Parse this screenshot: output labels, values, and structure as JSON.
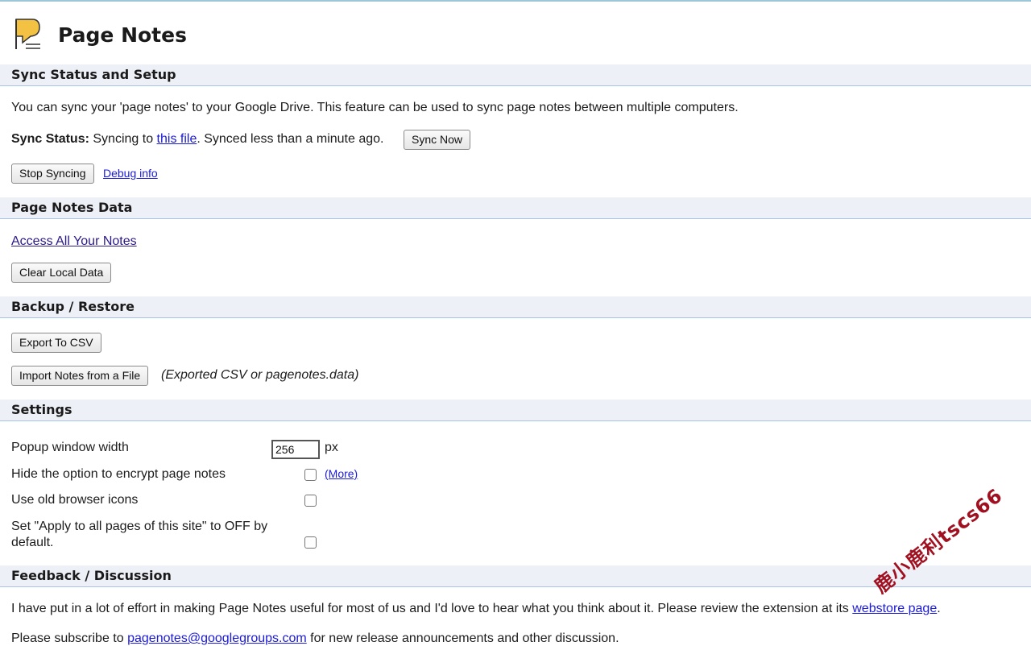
{
  "header": {
    "title": "Page Notes"
  },
  "sync": {
    "section_title": "Sync Status and Setup",
    "description": "You can sync your 'page notes' to your Google Drive. This feature can be used to sync page notes between multiple computers.",
    "status_label": "Sync Status:",
    "status_prefix": "Syncing to",
    "status_link": "this file",
    "status_suffix": ". Synced less than a minute ago.",
    "sync_now_label": "Sync Now",
    "stop_syncing_label": "Stop Syncing",
    "debug_link": "Debug info"
  },
  "data_section": {
    "section_title": "Page Notes Data",
    "access_link": "Access All Your Notes",
    "clear_label": "Clear Local Data"
  },
  "backup": {
    "section_title": "Backup / Restore",
    "export_label": "Export To CSV",
    "import_label": "Import Notes from a File",
    "import_hint": "(Exported CSV or pagenotes.data)"
  },
  "settings": {
    "section_title": "Settings",
    "popup_width_label": "Popup window width",
    "popup_width_value": "256",
    "popup_width_unit": "px",
    "hide_encrypt_label": "Hide the option to encrypt page notes",
    "more_link": "(More)",
    "old_icons_label": "Use old browser icons",
    "apply_all_label_line1": "Set \"Apply to all pages of this site\" to OFF by",
    "apply_all_label_line2": "default."
  },
  "feedback": {
    "section_title": "Feedback / Discussion",
    "review_text": "I have put in a lot of effort in making Page Notes useful for most of us and I'd love to hear what you think about it. Please review the extension at its",
    "webstore_link": "webstore page",
    "review_end": ".",
    "subscribe_prefix": "Please subscribe to",
    "subscribe_link": "pagenotes@googlegroups.com",
    "subscribe_suffix": "for new release announcements and other discussion."
  },
  "watermark": {
    "text": "鹿小鹿利tscs66"
  },
  "colors": {
    "section_background": "#eef0f7",
    "section_border": "#a9c2e8",
    "link": "#1a1adb",
    "watermark": "#a01020"
  }
}
